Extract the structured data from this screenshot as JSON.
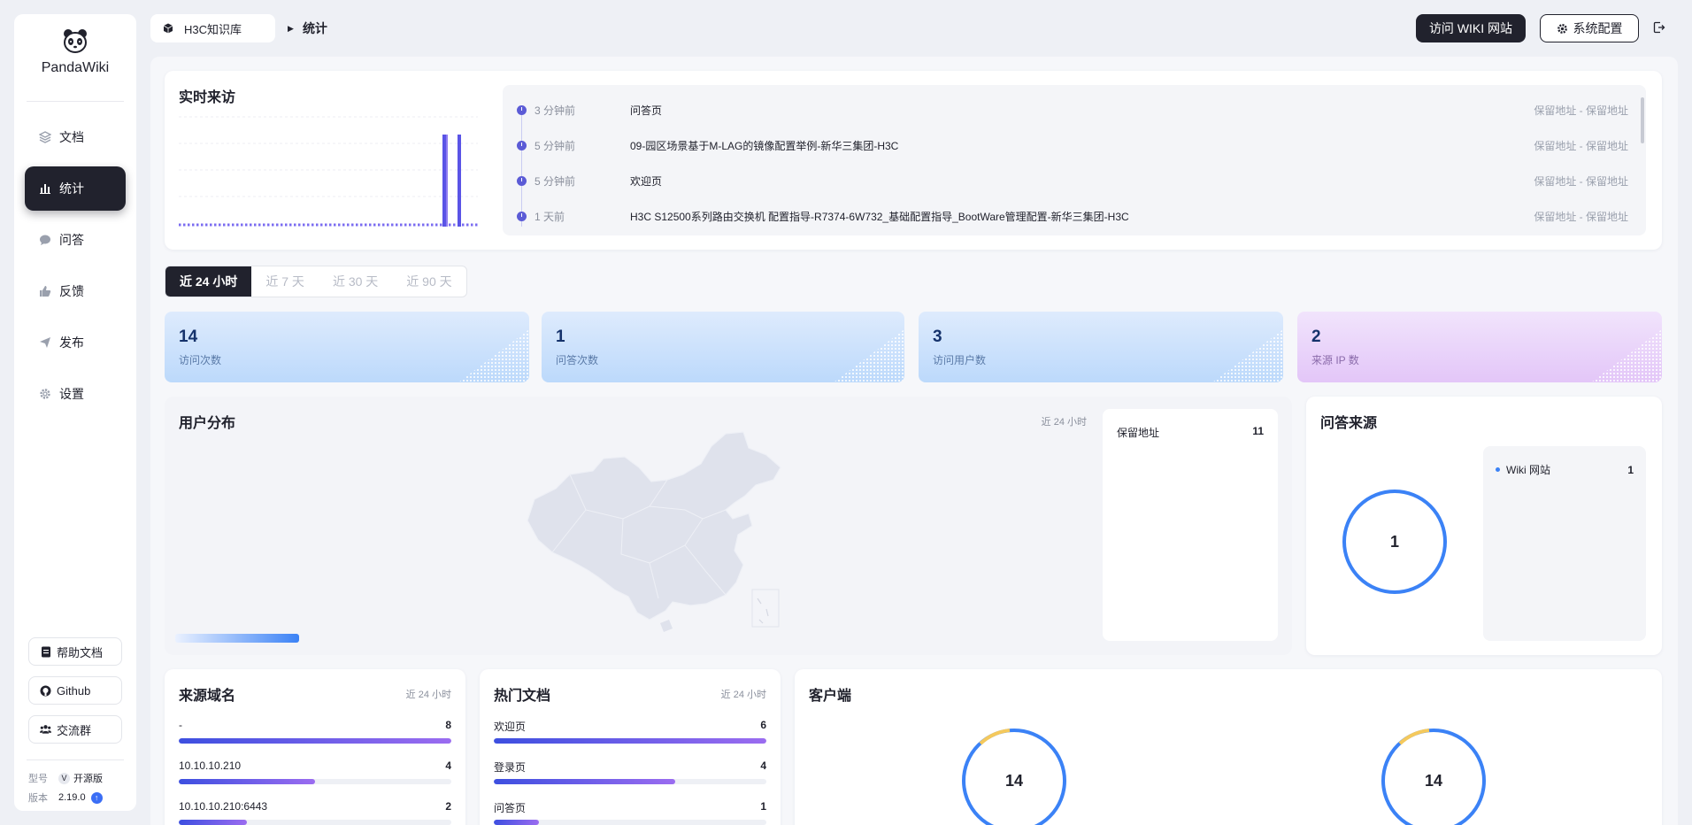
{
  "app": {
    "name": "PandaWiki"
  },
  "sidebar": {
    "items": [
      {
        "label": "文档",
        "icon": "layers-icon"
      },
      {
        "label": "统计",
        "icon": "bar-chart-icon",
        "active": true
      },
      {
        "label": "问答",
        "icon": "chat-bubble-icon"
      },
      {
        "label": "反馈",
        "icon": "thumb-icon"
      },
      {
        "label": "发布",
        "icon": "send-icon"
      },
      {
        "label": "设置",
        "icon": "gear-icon"
      }
    ],
    "buttons": [
      {
        "label": "帮助文档",
        "icon": "doc-icon"
      },
      {
        "label": "Github",
        "icon": "github-icon"
      },
      {
        "label": "交流群",
        "icon": "group-icon"
      }
    ],
    "meta": {
      "model_key": "型号",
      "model_value": "开源版",
      "model_badge": "V",
      "version_key": "版本",
      "version_value": "2.19.0"
    }
  },
  "header": {
    "kb_name": "H3C知识库",
    "current": "统计",
    "visit_wiki": "访问 WIKI 网站",
    "system_config": "系统配置"
  },
  "realtime": {
    "title": "实时来访",
    "visits": [
      {
        "time": "3 分钟前",
        "page": "问答页",
        "location": "保留地址 - 保留地址"
      },
      {
        "time": "5 分钟前",
        "page": "09-园区场景基于M-LAG的镜像配置举例-新华三集团-H3C",
        "location": "保留地址 - 保留地址"
      },
      {
        "time": "5 分钟前",
        "page": "欢迎页",
        "location": "保留地址 - 保留地址"
      },
      {
        "time": "1 天前",
        "page": "H3C S12500系列路由交换机 配置指导-R7374-6W732_基础配置指导_BootWare管理配置-新华三集团-H3C",
        "location": "保留地址 - 保留地址"
      }
    ]
  },
  "tabs": [
    {
      "label": "近 24 小时",
      "active": true
    },
    {
      "label": "近 7 天"
    },
    {
      "label": "近 30 天"
    },
    {
      "label": "近 90 天"
    }
  ],
  "stats": [
    {
      "value": "14",
      "label": "访问次数",
      "color": "#bcd9fb"
    },
    {
      "value": "1",
      "label": "问答次数",
      "color": "#bcd9fb"
    },
    {
      "value": "3",
      "label": "访问用户数",
      "color": "#bcd9fb"
    },
    {
      "value": "2",
      "label": "来源 IP 数",
      "color": "#e3c6f8"
    }
  ],
  "users": {
    "title": "用户分布",
    "range": "近 24 小时",
    "locations": [
      {
        "name": "保留地址",
        "value": "11"
      }
    ]
  },
  "qa_source": {
    "title": "问答来源",
    "total": "1",
    "items": [
      {
        "name": "Wiki 网站",
        "value": "1"
      }
    ]
  },
  "domains": {
    "title": "来源域名",
    "range": "近 24 小时",
    "rows": [
      {
        "name": "-",
        "value": "8",
        "share": 1.0
      },
      {
        "name": "10.10.10.210",
        "value": "4",
        "share": 0.5
      },
      {
        "name": "10.10.10.210:6443",
        "value": "2",
        "share": 0.25
      }
    ]
  },
  "hot_docs": {
    "title": "热门文档",
    "range": "近 24 小时",
    "rows": [
      {
        "name": "欢迎页",
        "value": "6",
        "share": 1.0
      },
      {
        "name": "登录页",
        "value": "4",
        "share": 0.667
      },
      {
        "name": "问答页",
        "value": "1",
        "share": 0.167
      }
    ]
  },
  "clients": {
    "title": "客户端",
    "rings": [
      {
        "value": "14"
      },
      {
        "value": "14"
      }
    ]
  },
  "colors": {
    "accent": "#21222d",
    "primary": "#3b82f6",
    "bar_start": "#3d4fe0",
    "bar_end": "#9b6cf0",
    "ring_highlight": "#f5c95c"
  }
}
